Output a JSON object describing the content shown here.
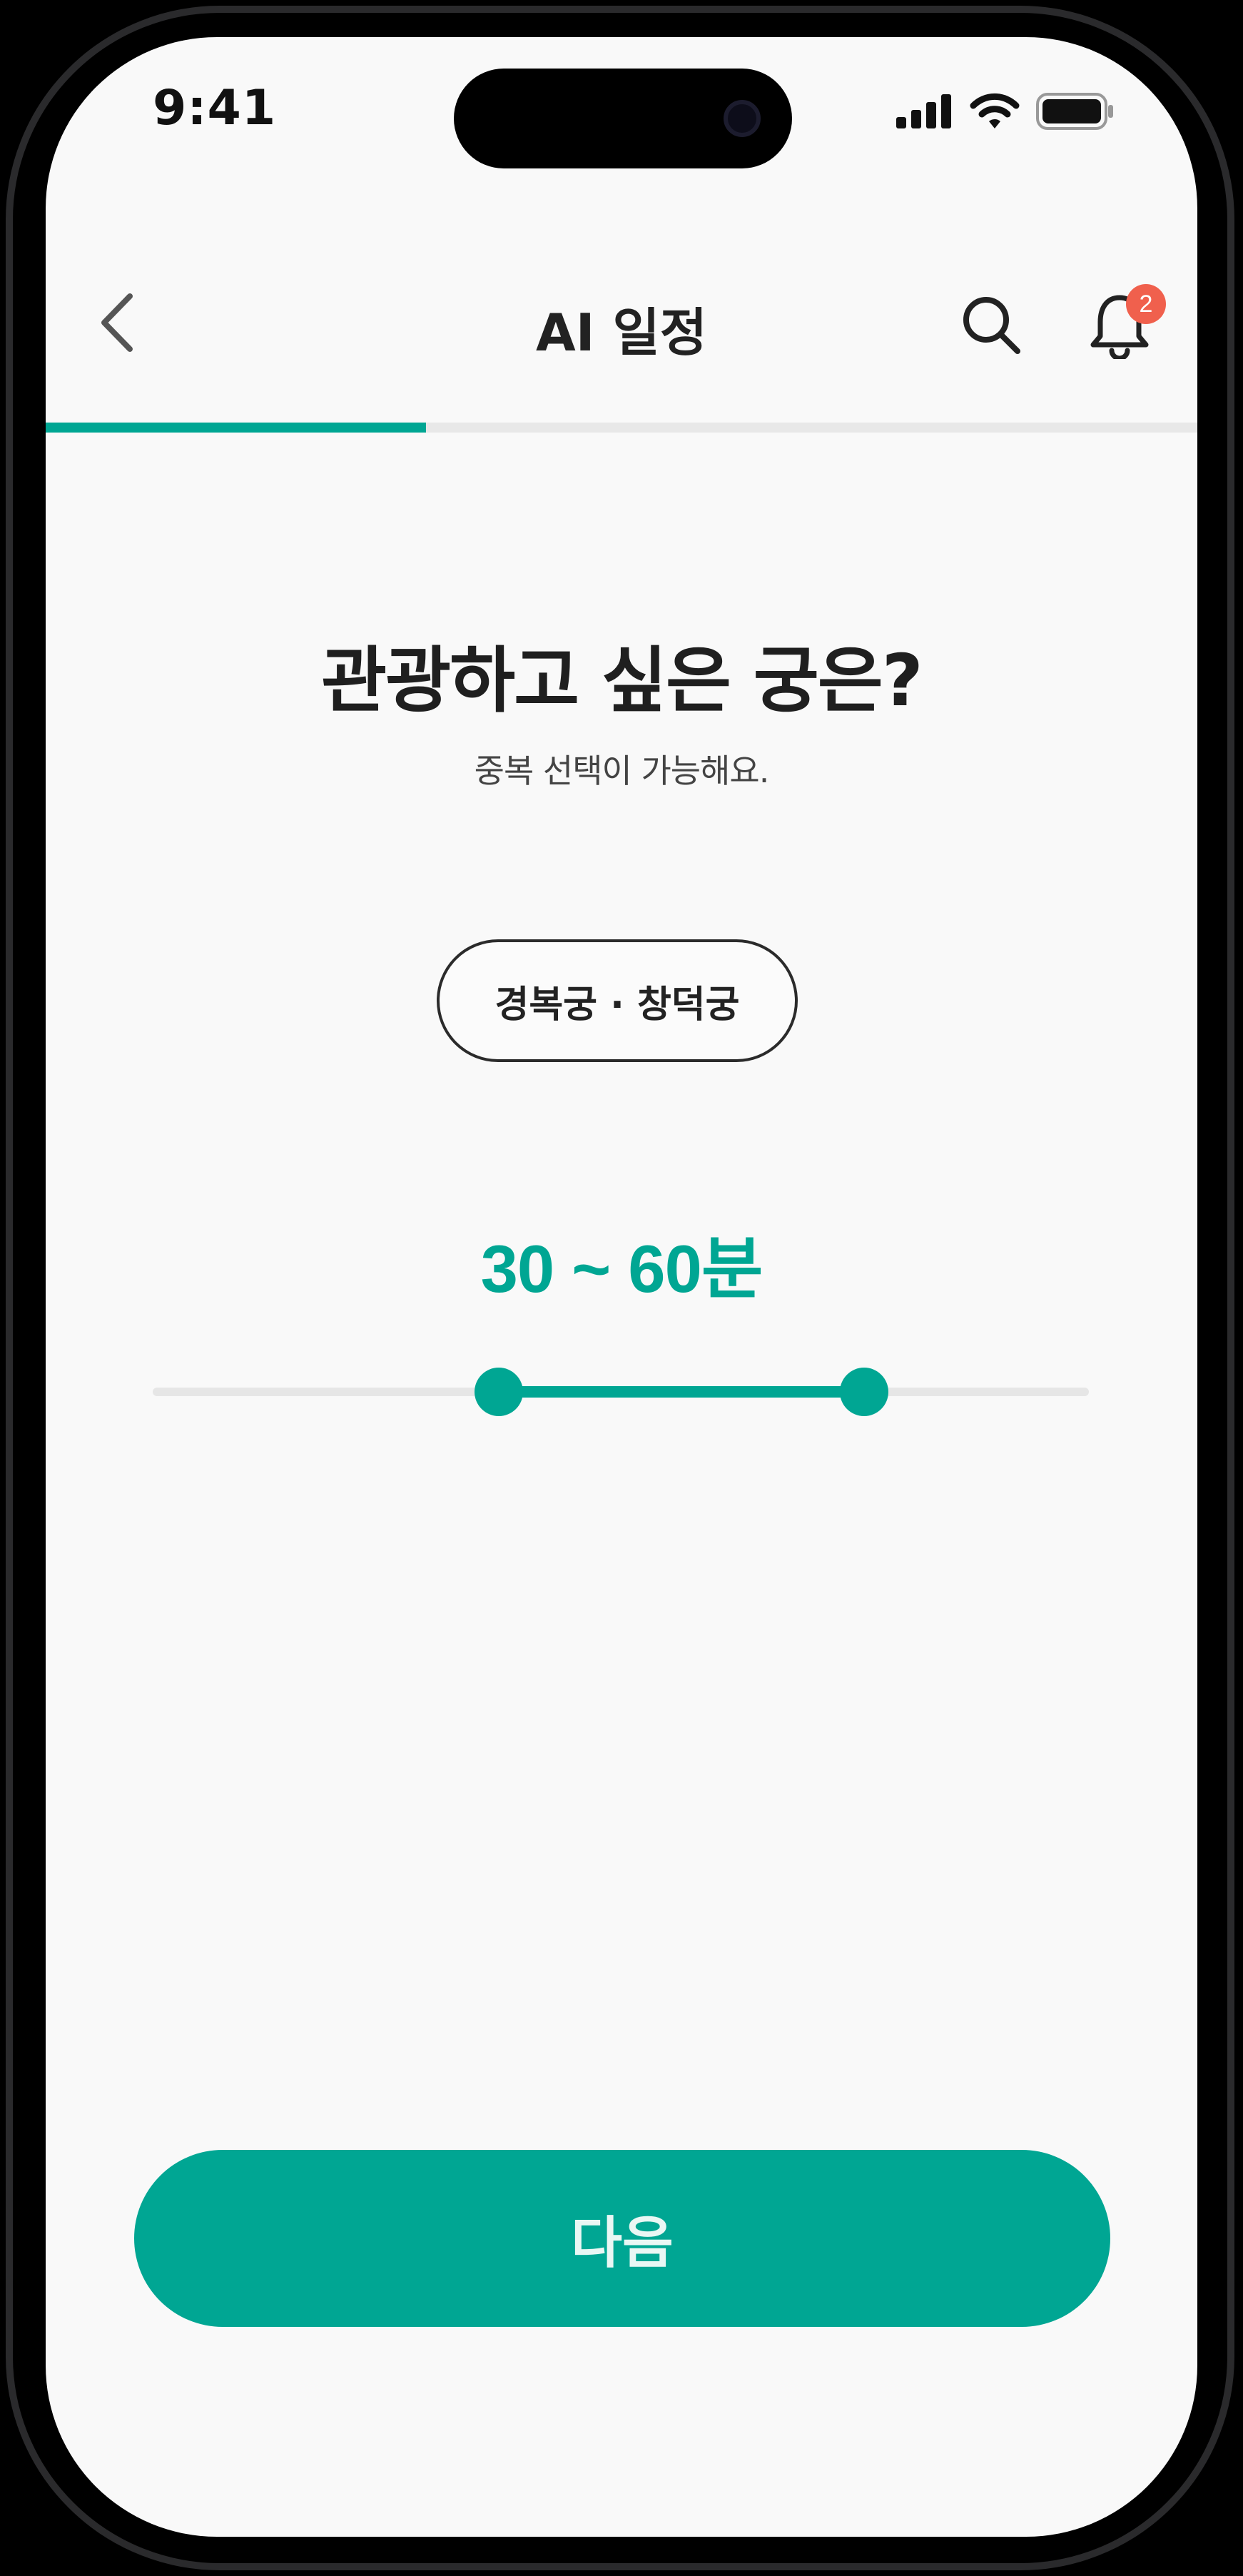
{
  "status_bar": {
    "time": "9:41"
  },
  "header": {
    "title": "AI 일정",
    "back_icon": "chevron-left-icon",
    "search_icon": "search-icon",
    "bell_icon": "bell-icon",
    "notification_count": "2"
  },
  "progress": {
    "fraction": 0.33
  },
  "question": {
    "title": "관광하고 싶은 궁은?",
    "subtitle": "중복 선택이 가능해요."
  },
  "chip": {
    "label": "경복궁 · 창덕궁"
  },
  "duration": {
    "label": "30 ~ 60분",
    "range_start_fraction": 0.37,
    "range_end_fraction": 0.76
  },
  "footer": {
    "next_label": "다음"
  },
  "colors": {
    "accent": "#00a693",
    "badge": "#f0604d",
    "background": "#f9f9f9"
  }
}
